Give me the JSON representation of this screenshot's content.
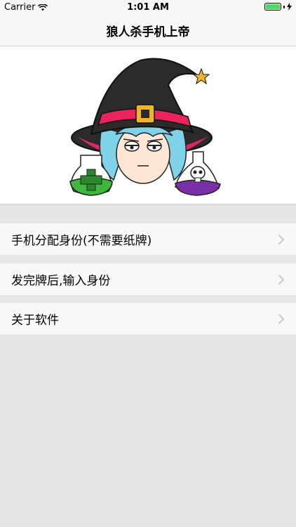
{
  "status_bar": {
    "carrier": "Carrier",
    "time": "1:01 AM"
  },
  "nav": {
    "title": "狼人杀手机上帝"
  },
  "hero": {
    "image": "witch-character-illustration"
  },
  "menu": {
    "items": [
      {
        "label": "手机分配身份(不需要纸牌)"
      },
      {
        "label": "发完牌后,输入身份"
      },
      {
        "label": "关于软件"
      }
    ]
  },
  "colors": {
    "hat": "#2b2b2b",
    "hat_band": "#e8245a",
    "buckle": "#f0b429",
    "hair": "#7fd3e8",
    "green_potion": "#3cb93c",
    "purple_potion": "#7a2ea8",
    "chevron": "#c7c7cc"
  }
}
